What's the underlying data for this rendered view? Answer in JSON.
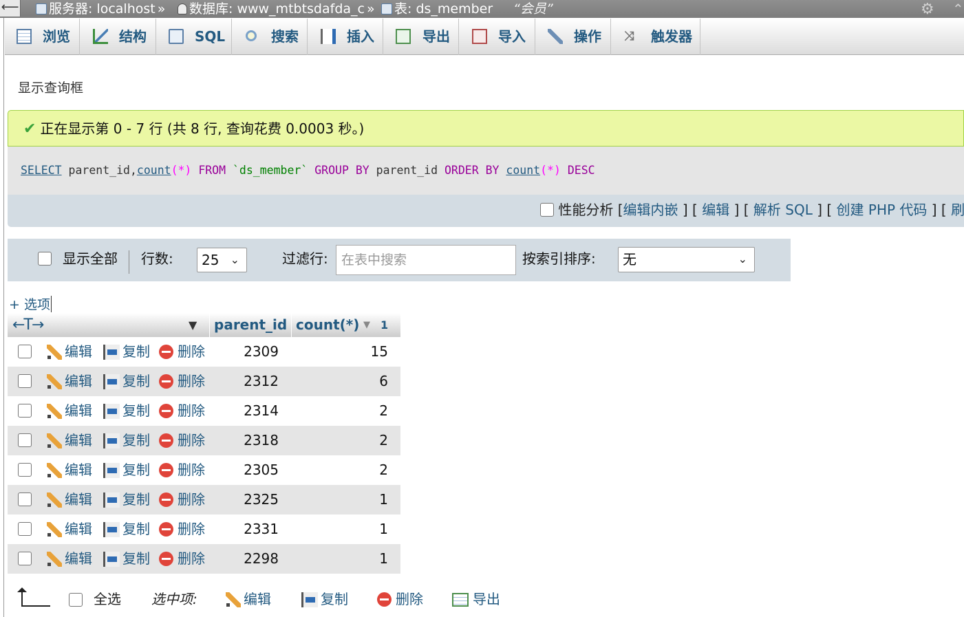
{
  "breadcrumb": {
    "server": "服务器: localhost",
    "database": "数据库: www_mtbtsdafda_c",
    "table": "表: ds_member",
    "comment": "“会员”",
    "sep": "»"
  },
  "tabs": [
    {
      "label": "浏览",
      "icon": "browse-icon"
    },
    {
      "label": "结构",
      "icon": "structure-icon"
    },
    {
      "label": "SQL",
      "icon": "sql-icon"
    },
    {
      "label": "搜索",
      "icon": "search-icon"
    },
    {
      "label": "插入",
      "icon": "insert-icon"
    },
    {
      "label": "导出",
      "icon": "export-icon"
    },
    {
      "label": "导入",
      "icon": "import-icon"
    },
    {
      "label": "操作",
      "icon": "wrench-icon"
    },
    {
      "label": "触发器",
      "icon": "trigger-icon"
    }
  ],
  "show_query_box": "显示查询框",
  "success_message": "正在显示第 0 - 7 行 (共 8 行, 查询花费 0.0003 秒。)",
  "sql": {
    "select": "SELECT",
    "col1": "parent_id",
    "comma": ",",
    "count1": "count",
    "star1": "(*)",
    "from": "FROM",
    "table": "`ds_member`",
    "group": "GROUP BY",
    "col2": "parent_id",
    "order": "ORDER BY",
    "count2": "count",
    "star2": "(*)",
    "desc": "DESC"
  },
  "profiling": {
    "label": "性能分析",
    "lb1": "[",
    "edit_inline": "编辑内嵌",
    "rb1": "] [",
    "edit": "编辑",
    "rb2": "] [",
    "explain": "解析 SQL",
    "rb3": "] [",
    "create_php": "创建 PHP 代码",
    "rb4": "] [",
    "refresh": "刷新",
    "rb5": "]"
  },
  "nav": {
    "show_all": "显示全部",
    "rows_label": "行数:",
    "rows_value": "25",
    "filter_label": "过滤行:",
    "filter_placeholder": "在表中搜索",
    "sort_label": "按索引排序:",
    "sort_value": "无"
  },
  "options_link": "+ 选项",
  "columns": {
    "arrows": "←T→",
    "parent_id": "parent_id",
    "count": "count(*)",
    "sort_order": "1"
  },
  "row_actions": {
    "edit": "编辑",
    "copy": "复制",
    "delete": "删除"
  },
  "rows": [
    {
      "parent_id": "2309",
      "count": "15"
    },
    {
      "parent_id": "2312",
      "count": "6"
    },
    {
      "parent_id": "2314",
      "count": "2"
    },
    {
      "parent_id": "2318",
      "count": "2"
    },
    {
      "parent_id": "2305",
      "count": "2"
    },
    {
      "parent_id": "2325",
      "count": "1"
    },
    {
      "parent_id": "2331",
      "count": "1"
    },
    {
      "parent_id": "2298",
      "count": "1"
    }
  ],
  "bottom": {
    "select_all": "全选",
    "with_selected": "选中项:",
    "edit": "编辑",
    "copy": "复制",
    "delete": "删除",
    "export": "导出"
  }
}
